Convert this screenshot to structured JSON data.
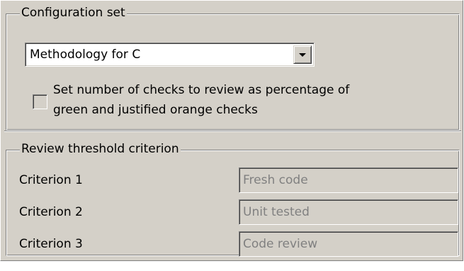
{
  "configuration_set": {
    "legend": "Configuration set",
    "methodology": {
      "selected_value": "Methodology for C",
      "dropdown_icon": "chevron-down-icon"
    },
    "percentage_checkbox": {
      "checked": false,
      "label": "Set number of checks to review as percentage of green and justified orange checks"
    }
  },
  "review_threshold": {
    "legend": "Review threshold criterion",
    "criteria": [
      {
        "label": "Criterion 1",
        "value": "Fresh code",
        "enabled": false
      },
      {
        "label": "Criterion 2",
        "value": "Unit tested",
        "enabled": false
      },
      {
        "label": "Criterion 3",
        "value": "Code review",
        "enabled": false
      }
    ]
  },
  "colors": {
    "panel": "#d4d0c8",
    "disabled_text": "#808080",
    "field_background": "#ffffff"
  }
}
